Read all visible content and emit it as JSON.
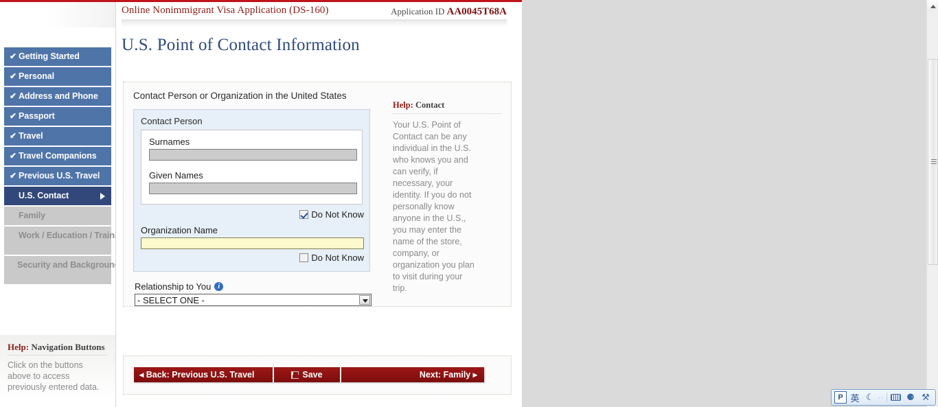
{
  "header": {
    "app_title": "Online Nonimmigrant Visa Application (DS-160)",
    "app_id_label": "Application ID",
    "app_id_value": "AA0045T68A",
    "page_title": "U.S. Point of Contact Information"
  },
  "sidebar": {
    "items": [
      {
        "label": "Getting Started",
        "check": "✔",
        "state": "done"
      },
      {
        "label": "Personal",
        "check": "✔",
        "state": "done"
      },
      {
        "label": "Address and Phone",
        "check": "✔",
        "state": "done"
      },
      {
        "label": "Passport",
        "check": "✔",
        "state": "done"
      },
      {
        "label": "Travel",
        "check": "✔",
        "state": "done"
      },
      {
        "label": "Travel Companions",
        "check": "✔",
        "state": "done"
      },
      {
        "label": "Previous U.S. Travel",
        "check": "✔",
        "state": "done"
      },
      {
        "label": "U.S. Contact",
        "check": "",
        "state": "active"
      },
      {
        "label": "Family",
        "check": "",
        "state": "future"
      },
      {
        "label": "Work / Education / Training",
        "check": "",
        "state": "future"
      },
      {
        "label": "Security and Background",
        "check": "",
        "state": "future"
      }
    ],
    "help": {
      "title_keyword": "Help:",
      "title_rest": " Navigation Buttons",
      "body": "Click on the buttons above to access previously entered data."
    }
  },
  "form": {
    "section_label": "Contact Person or Organization in the United States",
    "contact_person_label": "Contact Person",
    "surnames_label": "Surnames",
    "surnames_value": "",
    "given_names_label": "Given Names",
    "given_names_value": "",
    "do_not_know_label": "Do Not Know",
    "name_do_not_know_checked": true,
    "organization_label": "Organization Name",
    "organization_value": "",
    "org_do_not_know_checked": false,
    "relationship_label": "Relationship to You",
    "relationship_value": "- SELECT ONE -",
    "info_icon_glyph": "i"
  },
  "help_panel": {
    "title_keyword": "Help:",
    "title_rest": " Contact",
    "body": "Your U.S. Point of Contact can be any individual in the U.S. who knows you and can verify, if necessary, your identity. If you do not personally know anyone in the U.S., you may enter the name of the store, company, or organization you plan to visit during your trip."
  },
  "buttons": {
    "back": "◂ Back: Previous U.S. Travel",
    "save": "Save",
    "next": "Next: Family ▸"
  },
  "ime": {
    "logo": "P",
    "mode": "英",
    "moon": "☾",
    "dots": "··",
    "person": "⚈",
    "wrench": "⚒"
  },
  "colors": {
    "brand_red": "#8d1b14",
    "nav_blue": "#4f74a8",
    "nav_active": "#33487a",
    "title_blue": "#2f4a7c",
    "required_yellow": "#fdfbcd"
  }
}
